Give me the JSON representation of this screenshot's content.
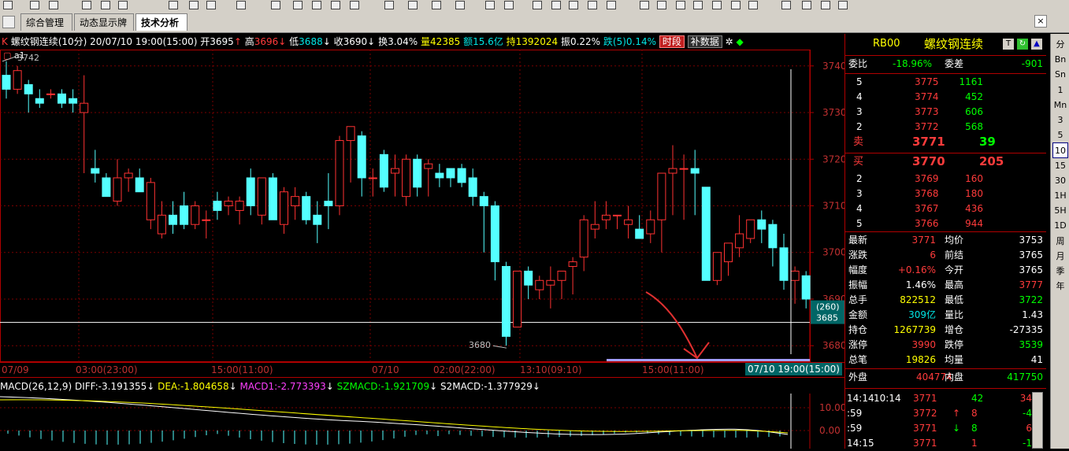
{
  "tabs": [
    {
      "label": "综合管理"
    },
    {
      "label": "动态显示牌"
    },
    {
      "label": "技术分析"
    }
  ],
  "info": {
    "title": "螺纹钢连续(10分)",
    "datetime": "20/07/10 19:00(15:00)",
    "open_label": "开",
    "open": "3695",
    "high_label": "高",
    "high": "3696",
    "low_label": "低",
    "low": "3688",
    "close_label": "收",
    "close": "3690",
    "turnover_label": "换",
    "turnover": "3.04%",
    "volume_label": "量",
    "volume": "42385",
    "amount_label": "额",
    "amount": "15.6亿",
    "oi_label": "持",
    "oi": "1392024",
    "amp_label": "振",
    "amp": "0.22%",
    "fall_label": "跌(5)",
    "fall": "0.14%",
    "btn_time": "时段",
    "btn_supp": "补数据",
    "sub_label": "a1"
  },
  "chart_data": {
    "type": "candlestick",
    "ylim": [
      3677,
      3743
    ],
    "y_ticks": [
      3740,
      3730,
      3720,
      3710,
      3700,
      3690,
      3680
    ],
    "marker_high": "3742",
    "marker_low": "3680",
    "ref_line": 3685,
    "ref_label_top": "(260)",
    "ref_label_bottom": "3685",
    "candles": [
      [
        3738,
        3741,
        3733,
        3735
      ],
      [
        3735,
        3740,
        3734,
        3739
      ],
      [
        3736,
        3737,
        3730,
        3734
      ],
      [
        3733,
        3735,
        3731,
        3732
      ],
      [
        3734,
        3735,
        3733,
        3734
      ],
      [
        3734,
        3735,
        3731,
        3732
      ],
      [
        3733,
        3735,
        3730,
        3732
      ],
      [
        3730,
        3738,
        3717,
        3732
      ],
      [
        3718,
        3722,
        3715,
        3717
      ],
      [
        3716,
        3717,
        3712,
        3712
      ],
      [
        3711,
        3720,
        3710,
        3716
      ],
      [
        3716,
        3718,
        3713,
        3717
      ],
      [
        3716,
        3718,
        3713,
        3713
      ],
      [
        3707,
        3716,
        3705,
        3715
      ],
      [
        3704,
        3711,
        3703,
        3708
      ],
      [
        3708,
        3711,
        3704,
        3706
      ],
      [
        3710,
        3713,
        3705,
        3706
      ],
      [
        3706,
        3711,
        3705,
        3710
      ],
      [
        3707,
        3709,
        3703,
        3707
      ],
      [
        3711,
        3713,
        3707,
        3709
      ],
      [
        3710,
        3712,
        3708,
        3711
      ],
      [
        3709,
        3712,
        3706,
        3711
      ],
      [
        3716,
        3718,
        3708,
        3710
      ],
      [
        3708,
        3716,
        3706,
        3716
      ],
      [
        3716,
        3717,
        3707,
        3707
      ],
      [
        3706,
        3714,
        3704,
        3713
      ],
      [
        3710,
        3714,
        3707,
        3712
      ],
      [
        3712,
        3713,
        3706,
        3707
      ],
      [
        3708,
        3711,
        3702,
        3706
      ],
      [
        3711,
        3717,
        3705,
        3710
      ],
      [
        3710,
        3725,
        3708,
        3724
      ],
      [
        3724,
        3727,
        3715,
        3727
      ],
      [
        3725,
        3726,
        3712,
        3716
      ],
      [
        3716,
        3718,
        3712,
        3716
      ],
      [
        3721,
        3722,
        3713,
        3714
      ],
      [
        3717,
        3721,
        3712,
        3718
      ],
      [
        3712,
        3721,
        3710,
        3720
      ],
      [
        3720,
        3721,
        3712,
        3714
      ],
      [
        3718,
        3720,
        3712,
        3719
      ],
      [
        3717,
        3719,
        3714,
        3716
      ],
      [
        3718,
        3718,
        3714,
        3716
      ],
      [
        3718,
        3719,
        3714,
        3715
      ],
      [
        3716,
        3718,
        3710,
        3712
      ],
      [
        3712,
        3713,
        3700,
        3710
      ],
      [
        3710,
        3711,
        3694,
        3698
      ],
      [
        3697,
        3698,
        3680,
        3682
      ],
      [
        3684,
        3686,
        3690,
        3696
      ],
      [
        3696,
        3697,
        3690,
        3693
      ],
      [
        3692,
        3695,
        3690,
        3694
      ],
      [
        3693,
        3697,
        3688,
        3694
      ],
      [
        3694,
        3696,
        3690,
        3696
      ],
      [
        3697,
        3699,
        3691,
        3698
      ],
      [
        3699,
        3708,
        3696,
        3707
      ],
      [
        3705,
        3711,
        3703,
        3706
      ],
      [
        3707,
        3711,
        3705,
        3708
      ],
      [
        3708,
        3708,
        3705,
        3708
      ],
      [
        3706,
        3710,
        3703,
        3707
      ],
      [
        3705,
        3708,
        3703,
        3703
      ],
      [
        3704,
        3709,
        3702,
        3707
      ],
      [
        3707,
        3715,
        3700,
        3717
      ],
      [
        3717,
        3723,
        3708,
        3718
      ],
      [
        3718,
        3721,
        3707,
        3718
      ],
      [
        3718,
        3722,
        3708,
        3717
      ],
      [
        3714,
        3714,
        3695,
        3694
      ],
      [
        3694,
        3698,
        3693,
        3700
      ],
      [
        3698,
        3702,
        3695,
        3702
      ],
      [
        3701,
        3708,
        3699,
        3704
      ],
      [
        3703,
        3707,
        3702,
        3707
      ],
      [
        3707,
        3709,
        3702,
        3705
      ],
      [
        3706,
        3707,
        3697,
        3701
      ],
      [
        3701,
        3704,
        3692,
        3694
      ],
      [
        3694,
        3697,
        3689,
        3696
      ],
      [
        3695,
        3696,
        3688,
        3690
      ]
    ],
    "x_labels": [
      "07/09",
      "03:00(23:00)",
      "15:00(11:00)",
      "07/10",
      "02:00(22:00)",
      "13:10(09:10)",
      "15:00(11:00)",
      "07/10 19:00(15:00)"
    ],
    "macd": {
      "label": "MACD(26,12,9)",
      "diff": "DIFF:-3.191355",
      "dea": "DEA:-1.804658",
      "macd1": "MACD1:-2.773393",
      "szmacd": "SZMACD:-1.921709",
      "s2macd": "S2MACD:-1.377929",
      "ticks": [
        "10.00",
        "0.00"
      ]
    }
  },
  "panel": {
    "code": "RB00",
    "name": "螺纹钢连续",
    "weibi_label": "委比",
    "weibi": "-18.96%",
    "weicha_label": "委差",
    "weicha": "-901",
    "asks": [
      {
        "lvl": "5",
        "price": "3775",
        "vol": "1161"
      },
      {
        "lvl": "4",
        "price": "3774",
        "vol": "452"
      },
      {
        "lvl": "3",
        "price": "3773",
        "vol": "606"
      },
      {
        "lvl": "2",
        "price": "3772",
        "vol": "568"
      }
    ],
    "sell_label": "卖",
    "sell_price": "3771",
    "sell_vol": "39",
    "buy_label": "买",
    "buy_price": "3770",
    "buy_vol": "205",
    "bids": [
      {
        "lvl": "2",
        "price": "3769",
        "vol": "160"
      },
      {
        "lvl": "3",
        "price": "3768",
        "vol": "180"
      },
      {
        "lvl": "4",
        "price": "3767",
        "vol": "436"
      },
      {
        "lvl": "5",
        "price": "3766",
        "vol": "944"
      }
    ],
    "stats": [
      {
        "l1": "最新",
        "v1": "3771",
        "c1": "r",
        "l2": "均价",
        "v2": "3753",
        "c2": "w"
      },
      {
        "l1": "涨跌",
        "v1": "6",
        "c1": "r",
        "l2": "前结",
        "v2": "3765",
        "c2": "w"
      },
      {
        "l1": "幅度",
        "v1": "+0.16%",
        "c1": "r",
        "l2": "今开",
        "v2": "3765",
        "c2": "w"
      },
      {
        "l1": "振幅",
        "v1": "1.46%",
        "c1": "w",
        "l2": "最高",
        "v2": "3777",
        "c2": "r"
      },
      {
        "l1": "总手",
        "v1": "822512",
        "c1": "y",
        "l2": "最低",
        "v2": "3722",
        "c2": "g"
      },
      {
        "l1": "金额",
        "v1": "309亿",
        "c1": "c",
        "l2": "量比",
        "v2": "1.43",
        "c2": "w"
      },
      {
        "l1": "持仓",
        "v1": "1267739",
        "c1": "y",
        "l2": "增仓",
        "v2": "-27335",
        "c2": "w"
      },
      {
        "l1": "涨停",
        "v1": "3990",
        "c1": "r",
        "l2": "跌停",
        "v2": "3539",
        "c2": "g"
      },
      {
        "l1": "总笔",
        "v1": "19826",
        "c1": "y",
        "l2": "均量",
        "v2": "41",
        "c2": "w"
      }
    ],
    "outer_label": "外盘",
    "outer": "404774",
    "inner_label": "内盘",
    "inner": "417750",
    "ticks": [
      {
        "time": "14:14",
        "time2": "10:14",
        "price": "3771",
        "vol": "42",
        "oi": "34",
        "pc": "r",
        "vc": "g",
        "arrow": "",
        "oc": "r"
      },
      {
        "time": ":59",
        "time2": "",
        "price": "3772",
        "vol": "8",
        "oi": "-4",
        "pc": "r",
        "vc": "r",
        "arrow": "↑",
        "oc": "g"
      },
      {
        "time": ":59",
        "time2": "",
        "price": "3771",
        "vol": "8",
        "oi": "6",
        "pc": "r",
        "vc": "g",
        "arrow": "↓",
        "oc": "r"
      },
      {
        "time": "14:15",
        "time2": "",
        "price": "3771",
        "vol": "1",
        "oi": "-1",
        "pc": "r",
        "vc": "r",
        "arrow": "",
        "oc": "g"
      }
    ]
  },
  "sidebar": [
    "分",
    "Bn",
    "Sn",
    "1",
    "Mn",
    "3",
    "5",
    "10",
    "15",
    "30",
    "1H",
    "5H",
    "1D",
    "周",
    "月",
    "季",
    "年"
  ],
  "sidebar_active": "10"
}
